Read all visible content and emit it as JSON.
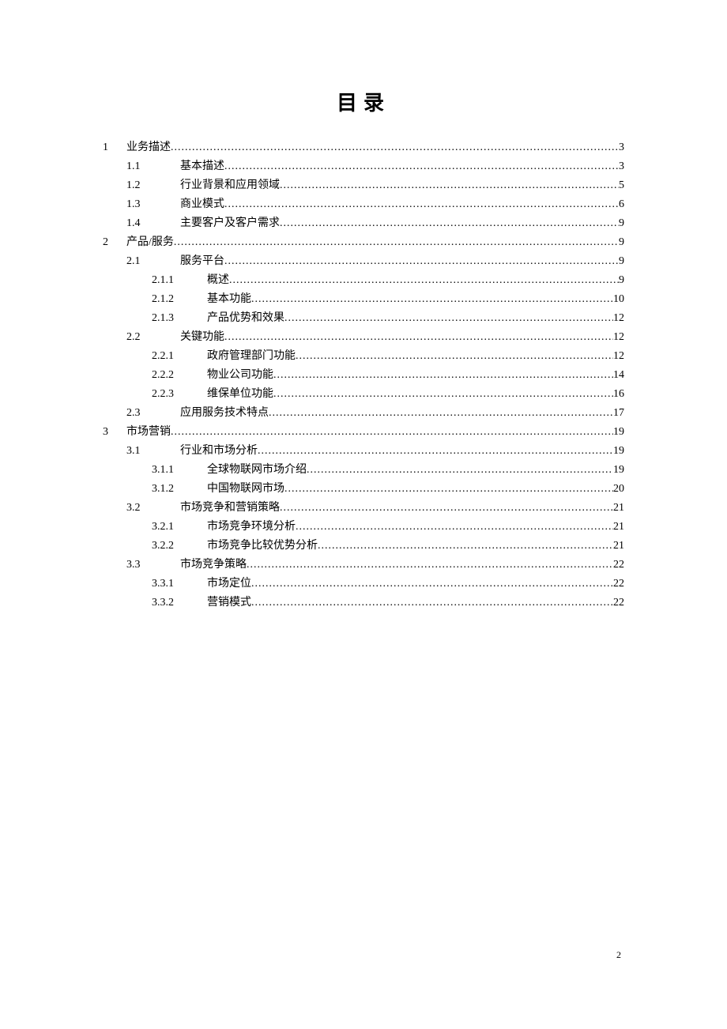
{
  "title": "目录",
  "page_number": "2",
  "toc": [
    {
      "level": 1,
      "num": "1",
      "text": "业务描述",
      "page": "3"
    },
    {
      "level": 2,
      "num": "1.1",
      "text": "基本描述",
      "page": "3"
    },
    {
      "level": 2,
      "num": "1.2",
      "text": "行业背景和应用领域",
      "page": "5"
    },
    {
      "level": 2,
      "num": "1.3",
      "text": "商业模式",
      "page": "6"
    },
    {
      "level": 2,
      "num": "1.4",
      "text": "主要客户及客户需求",
      "page": "9"
    },
    {
      "level": 1,
      "num": "2",
      "text": "产品/服务",
      "page": "9"
    },
    {
      "level": 2,
      "num": "2.1",
      "text": "服务平台",
      "page": "9"
    },
    {
      "level": 3,
      "num": "2.1.1",
      "text": "概述",
      "page": "9"
    },
    {
      "level": 3,
      "num": "2.1.2",
      "text": "基本功能",
      "page": "10"
    },
    {
      "level": 3,
      "num": "2.1.3",
      "text": "产品优势和效果",
      "page": "12"
    },
    {
      "level": 2,
      "num": "2.2",
      "text": "关键功能",
      "page": "12"
    },
    {
      "level": 3,
      "num": "2.2.1",
      "text": "政府管理部门功能",
      "page": "12"
    },
    {
      "level": 3,
      "num": "2.2.2",
      "text": "物业公司功能",
      "page": "14"
    },
    {
      "level": 3,
      "num": "2.2.3",
      "text": "维保单位功能",
      "page": "16"
    },
    {
      "level": 2,
      "num": "2.3",
      "text": "应用服务技术特点",
      "page": "17"
    },
    {
      "level": 1,
      "num": "3",
      "text": "市场营销",
      "page": "19"
    },
    {
      "level": 2,
      "num": "3.1",
      "text": "行业和市场分析",
      "page": "19"
    },
    {
      "level": 3,
      "num": "3.1.1",
      "text": "全球物联网市场介绍",
      "page": "19"
    },
    {
      "level": 3,
      "num": "3.1.2",
      "text": "中国物联网市场",
      "page": "20"
    },
    {
      "level": 2,
      "num": "3.2",
      "text": "市场竞争和营销策略",
      "page": "21"
    },
    {
      "level": 3,
      "num": "3.2.1",
      "text": "市场竞争环境分析",
      "page": "21"
    },
    {
      "level": 3,
      "num": "3.2.2",
      "text": "市场竞争比较优势分析",
      "page": "21"
    },
    {
      "level": 2,
      "num": "3.3",
      "text": "市场竞争策略",
      "page": "22"
    },
    {
      "level": 3,
      "num": "3.3.1",
      "text": "市场定位",
      "page": "22"
    },
    {
      "level": 3,
      "num": "3.3.2",
      "text": "营销模式",
      "page": "22"
    }
  ]
}
